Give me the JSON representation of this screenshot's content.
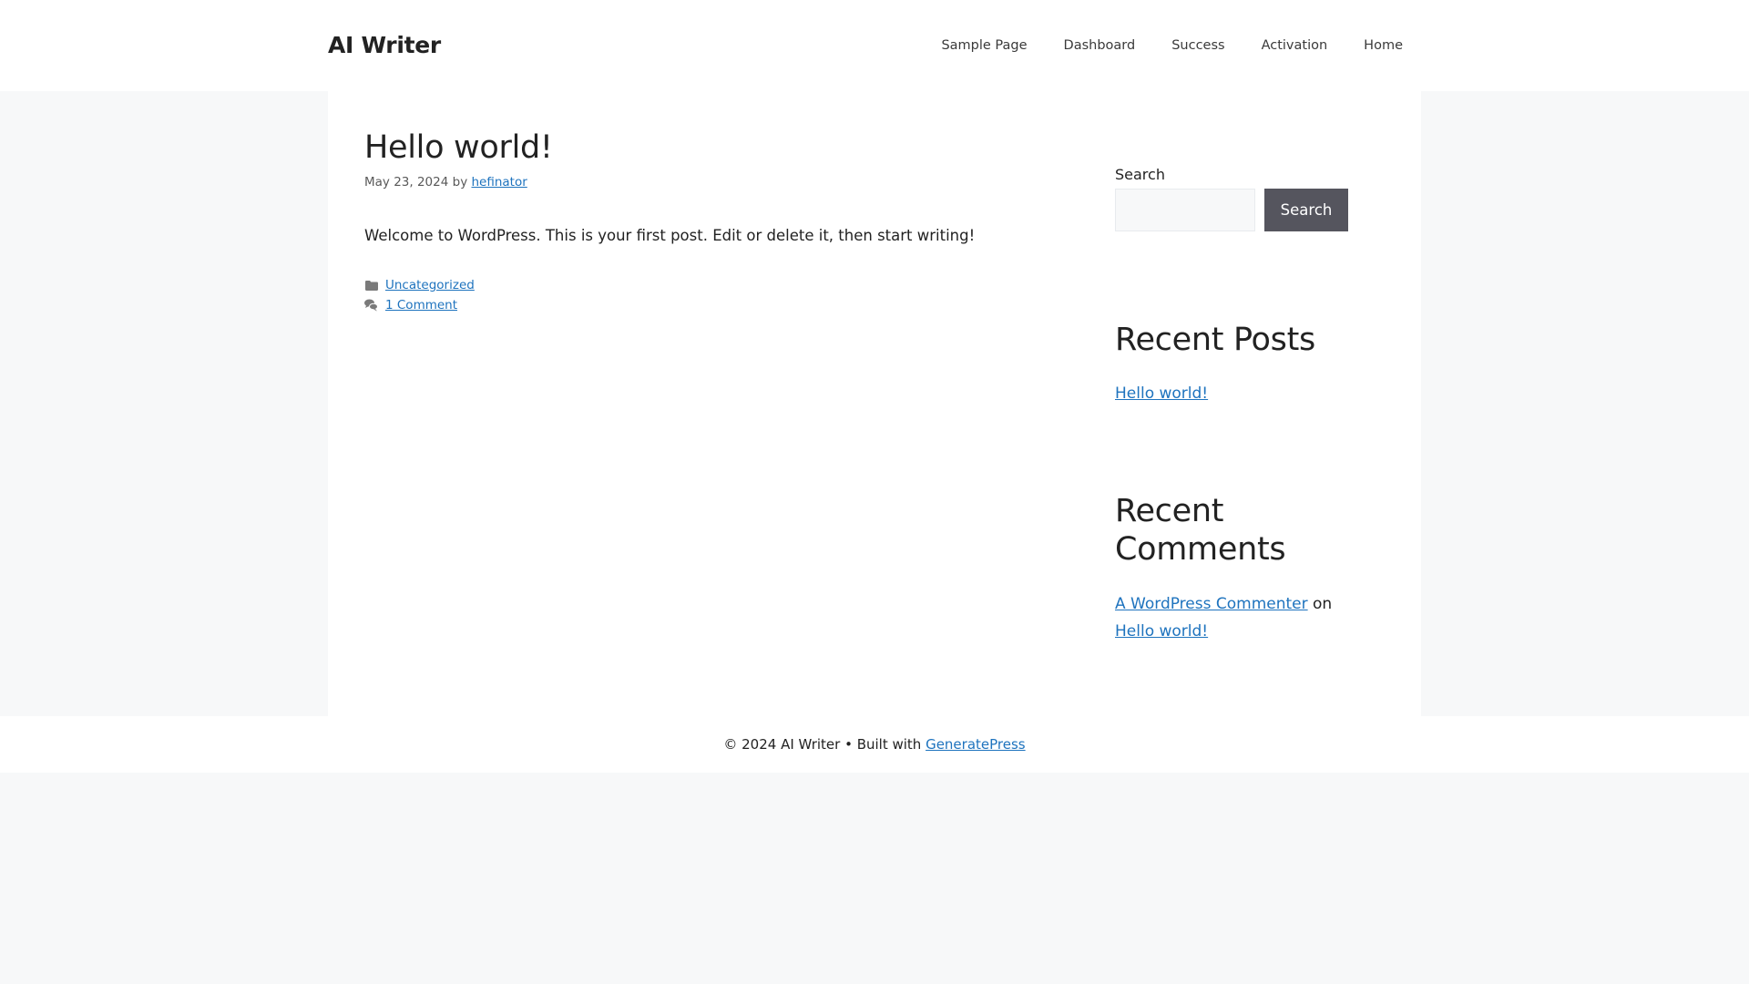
{
  "header": {
    "site_title": "AI Writer",
    "nav": [
      {
        "label": "Sample Page"
      },
      {
        "label": "Dashboard"
      },
      {
        "label": "Success"
      },
      {
        "label": "Activation"
      },
      {
        "label": "Home"
      }
    ]
  },
  "post": {
    "title": "Hello world!",
    "date": "May 23, 2024",
    "by": "by",
    "author": "hefinator",
    "content": "Welcome to WordPress. This is your first post. Edit or delete it, then start writing!",
    "category": "Uncategorized",
    "comments": "1 Comment",
    "icons": {
      "category": "folder-icon",
      "comments": "comments-icon"
    }
  },
  "sidebar": {
    "search": {
      "label": "Search",
      "placeholder": "",
      "value": "",
      "button_label": "Search"
    },
    "recent_posts": {
      "title": "Recent Posts",
      "items": [
        {
          "label": "Hello world!"
        }
      ]
    },
    "recent_comments": {
      "title": "Recent Comments",
      "items": [
        {
          "author": "A WordPress Commenter",
          "connector": "on",
          "post": "Hello world!"
        }
      ]
    }
  },
  "footer": {
    "copyright": "© 2024 AI Writer • Built with",
    "link_label": "GeneratePress"
  },
  "colors": {
    "link": "#1e73be",
    "background": "#f7f8f9",
    "button": "#55555e",
    "text": "#222222"
  }
}
